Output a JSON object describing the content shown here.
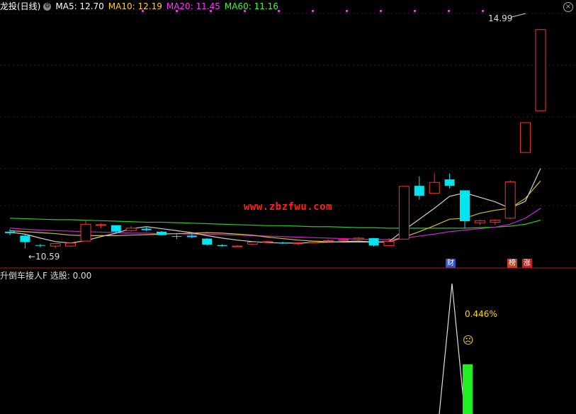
{
  "header": {
    "stock_label": "龙投(日线)",
    "indicators": [
      {
        "label": "MA5: 12.70",
        "color": "#ffffff"
      },
      {
        "label": "MA10: 12.19",
        "color": "#ffd700"
      },
      {
        "label": "MA20: 11.45",
        "color": "#ff33ff"
      },
      {
        "label": "MA60: 11.16",
        "color": "#33ff33"
      }
    ],
    "close_icon": "close-icon",
    "settings_icon": "gear-icon"
  },
  "price_pane": {
    "high_label": "14.99",
    "low_label": "←10.59",
    "watermark": "www.zbzfwu.com",
    "badges": [
      {
        "text": "财",
        "bg": "#3050c0"
      },
      {
        "text": "榜",
        "bg": "#c04020"
      },
      {
        "text": "涨",
        "bg": "#c02020"
      }
    ]
  },
  "indicator_pane": {
    "title": "升倒车接人F  选股: 0.00",
    "value_label": "0.446",
    "percent_sign": "%",
    "emoji": "☹"
  },
  "chart_data": {
    "type": "candlestick",
    "ylim": [
      10.2,
      15.3
    ],
    "candles": [
      {
        "o": 10.93,
        "h": 10.98,
        "l": 10.86,
        "c": 10.9
      },
      {
        "o": 10.85,
        "h": 10.88,
        "l": 10.59,
        "c": 10.72
      },
      {
        "o": 10.66,
        "h": 10.68,
        "l": 10.62,
        "c": 10.65
      },
      {
        "o": 10.64,
        "h": 10.7,
        "l": 10.6,
        "c": 10.69
      },
      {
        "o": 10.64,
        "h": 10.71,
        "l": 10.62,
        "c": 10.7
      },
      {
        "o": 10.74,
        "h": 11.17,
        "l": 10.74,
        "c": 11.08
      },
      {
        "o": 11.07,
        "h": 11.1,
        "l": 11.0,
        "c": 11.07
      },
      {
        "o": 11.06,
        "h": 11.06,
        "l": 10.9,
        "c": 10.93
      },
      {
        "o": 10.95,
        "h": 11.04,
        "l": 10.93,
        "c": 11.0
      },
      {
        "o": 10.99,
        "h": 11.03,
        "l": 10.94,
        "c": 10.96
      },
      {
        "o": 10.93,
        "h": 10.94,
        "l": 10.85,
        "c": 10.86
      },
      {
        "o": 10.84,
        "h": 10.88,
        "l": 10.78,
        "c": 10.83
      },
      {
        "o": 10.85,
        "h": 10.88,
        "l": 10.8,
        "c": 10.82
      },
      {
        "o": 10.79,
        "h": 10.8,
        "l": 10.65,
        "c": 10.67
      },
      {
        "o": 10.66,
        "h": 10.68,
        "l": 10.63,
        "c": 10.64
      },
      {
        "o": 10.63,
        "h": 10.66,
        "l": 10.62,
        "c": 10.64
      },
      {
        "o": 10.68,
        "h": 10.73,
        "l": 10.66,
        "c": 10.72
      },
      {
        "o": 10.72,
        "h": 10.75,
        "l": 10.7,
        "c": 10.73
      },
      {
        "o": 10.71,
        "h": 10.73,
        "l": 10.68,
        "c": 10.7
      },
      {
        "o": 10.69,
        "h": 10.72,
        "l": 10.67,
        "c": 10.7
      },
      {
        "o": 10.7,
        "h": 10.73,
        "l": 10.69,
        "c": 10.72
      },
      {
        "o": 10.74,
        "h": 10.77,
        "l": 10.72,
        "c": 10.75
      },
      {
        "o": 10.76,
        "h": 10.78,
        "l": 10.74,
        "c": 10.77
      },
      {
        "o": 10.78,
        "h": 10.82,
        "l": 10.76,
        "c": 10.8
      },
      {
        "o": 10.8,
        "h": 10.8,
        "l": 10.63,
        "c": 10.65
      },
      {
        "o": 10.65,
        "h": 10.8,
        "l": 10.64,
        "c": 10.73
      },
      {
        "o": 10.78,
        "h": 11.85,
        "l": 10.78,
        "c": 11.84
      },
      {
        "o": 11.85,
        "h": 12.04,
        "l": 11.57,
        "c": 11.65
      },
      {
        "o": 11.7,
        "h": 12.1,
        "l": 11.68,
        "c": 11.92
      },
      {
        "o": 11.98,
        "h": 12.1,
        "l": 11.8,
        "c": 11.85
      },
      {
        "o": 11.76,
        "h": 11.76,
        "l": 11.0,
        "c": 11.14
      },
      {
        "o": 11.11,
        "h": 11.17,
        "l": 11.07,
        "c": 11.15
      },
      {
        "o": 11.12,
        "h": 11.18,
        "l": 11.07,
        "c": 11.16
      },
      {
        "o": 11.2,
        "h": 11.96,
        "l": 11.18,
        "c": 11.93
      },
      {
        "o": 12.52,
        "h": 13.13,
        "l": 12.52,
        "c": 13.12
      },
      {
        "o": 13.36,
        "h": 14.99,
        "l": 13.36,
        "c": 14.99
      }
    ],
    "ma5": [
      10.92,
      10.88,
      10.8,
      10.73,
      10.7,
      10.75,
      10.83,
      10.9,
      10.99,
      11.03,
      10.99,
      10.95,
      10.91,
      10.85,
      10.8,
      10.76,
      10.73,
      10.71,
      10.7,
      10.7,
      10.71,
      10.72,
      10.73,
      10.74,
      10.72,
      10.73,
      10.96,
      11.18,
      11.4,
      11.64,
      11.71,
      11.62,
      11.53,
      11.4,
      11.54,
      12.2
    ],
    "ma10": [
      10.95,
      10.93,
      10.91,
      10.89,
      10.86,
      10.85,
      10.85,
      10.85,
      10.86,
      10.87,
      10.88,
      10.89,
      10.9,
      10.91,
      10.9,
      10.88,
      10.86,
      10.82,
      10.79,
      10.76,
      10.74,
      10.73,
      10.72,
      10.72,
      10.72,
      10.72,
      10.82,
      10.93,
      11.05,
      11.18,
      11.2,
      11.3,
      11.36,
      11.4,
      11.6,
      11.95
    ],
    "ma20": [
      11.0,
      10.98,
      10.96,
      10.95,
      10.94,
      10.93,
      10.92,
      10.91,
      10.9,
      10.9,
      10.89,
      10.89,
      10.88,
      10.88,
      10.87,
      10.86,
      10.85,
      10.84,
      10.83,
      10.82,
      10.81,
      10.8,
      10.79,
      10.78,
      10.77,
      10.77,
      10.8,
      10.84,
      10.88,
      10.93,
      10.96,
      10.99,
      11.02,
      11.08,
      11.2,
      11.4
    ],
    "ma60": [
      11.2,
      11.19,
      11.18,
      11.17,
      11.17,
      11.16,
      11.15,
      11.14,
      11.13,
      11.12,
      11.12,
      11.11,
      11.1,
      11.09,
      11.08,
      11.07,
      11.06,
      11.05,
      11.05,
      11.04,
      11.03,
      11.03,
      11.02,
      11.01,
      11.01,
      11.0,
      11.0,
      11.0,
      11.0,
      11.0,
      11.0,
      11.01,
      11.02,
      11.04,
      11.08,
      11.16
    ],
    "bars": [
      0,
      0,
      0,
      0,
      0,
      0,
      0,
      0,
      0,
      0,
      0,
      0,
      0,
      0,
      0,
      0,
      0,
      0,
      0,
      0,
      0,
      0,
      0,
      0,
      0,
      0,
      0,
      0,
      0,
      0,
      0,
      1,
      0,
      0,
      0,
      0
    ],
    "signal_line": [
      0,
      0,
      0,
      0,
      0,
      0,
      0,
      0,
      0,
      0,
      0,
      0,
      0,
      0,
      0,
      0,
      0,
      0,
      0,
      0,
      0,
      0,
      0,
      0,
      0,
      0,
      0,
      0,
      0.6,
      1.0,
      0.3,
      0,
      0,
      0,
      0,
      0
    ]
  }
}
